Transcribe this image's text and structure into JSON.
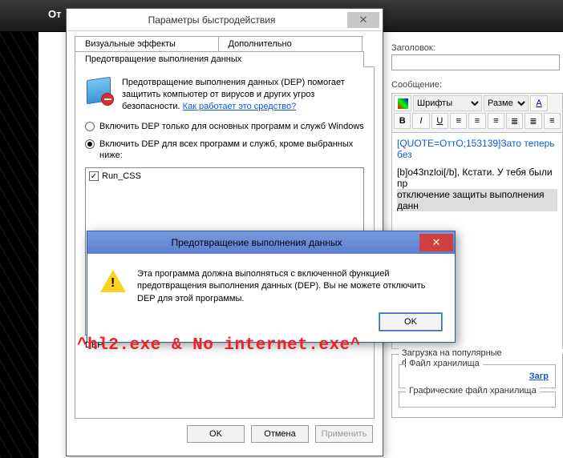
{
  "dark_bar": {
    "text": "От"
  },
  "right": {
    "title_label": "Заголовок:",
    "message_label": "Сообщение:",
    "font_select": "Шрифты",
    "size_select": "Разме",
    "body_line1": "[QUOTE=ОттО;153139]Зато теперь без",
    "body_line2a": "[b]o43nzloi[/b]",
    "body_line2b": ", Кстати. У тебя были пр",
    "body_line3": "отключение защиты выполнения данн",
    "upload_group": "Загрузка на популярные файлхранилищ",
    "file_group": "Файл хранилища",
    "upload_link": "Загр",
    "graphic_group": "Графические файл хранилища"
  },
  "perf": {
    "title": "Параметры быстродействия",
    "tabs": {
      "visual": "Визуальные эффекты",
      "advanced": "Дополнительно",
      "dep": "Предотвращение выполнения данных"
    },
    "dep_desc": "Предотвращение выполнения данных (DEP) помогает защитить компьютер от вирусов и других угроз безопасности. ",
    "dep_link": "Как работает это средство?",
    "radio1": "Включить DEP только для основных программ и служб Windows",
    "radio2": "Включить DEP для всех программ и служб, кроме выбранных ниже:",
    "list_item": "Run_CSS",
    "footer": "DEP.",
    "ok": "OK",
    "cancel": "Отмена",
    "apply": "Применить"
  },
  "msg": {
    "title": "Предотвращение выполнения данных",
    "text": "Эта программа должна выполняться с включенной функцией предотвращения выполнения данных (DEP). Вы не можете отключить DEP для этой программы.",
    "ok": "OK"
  },
  "overlay": "^hl2.exe & No internet.exe^"
}
